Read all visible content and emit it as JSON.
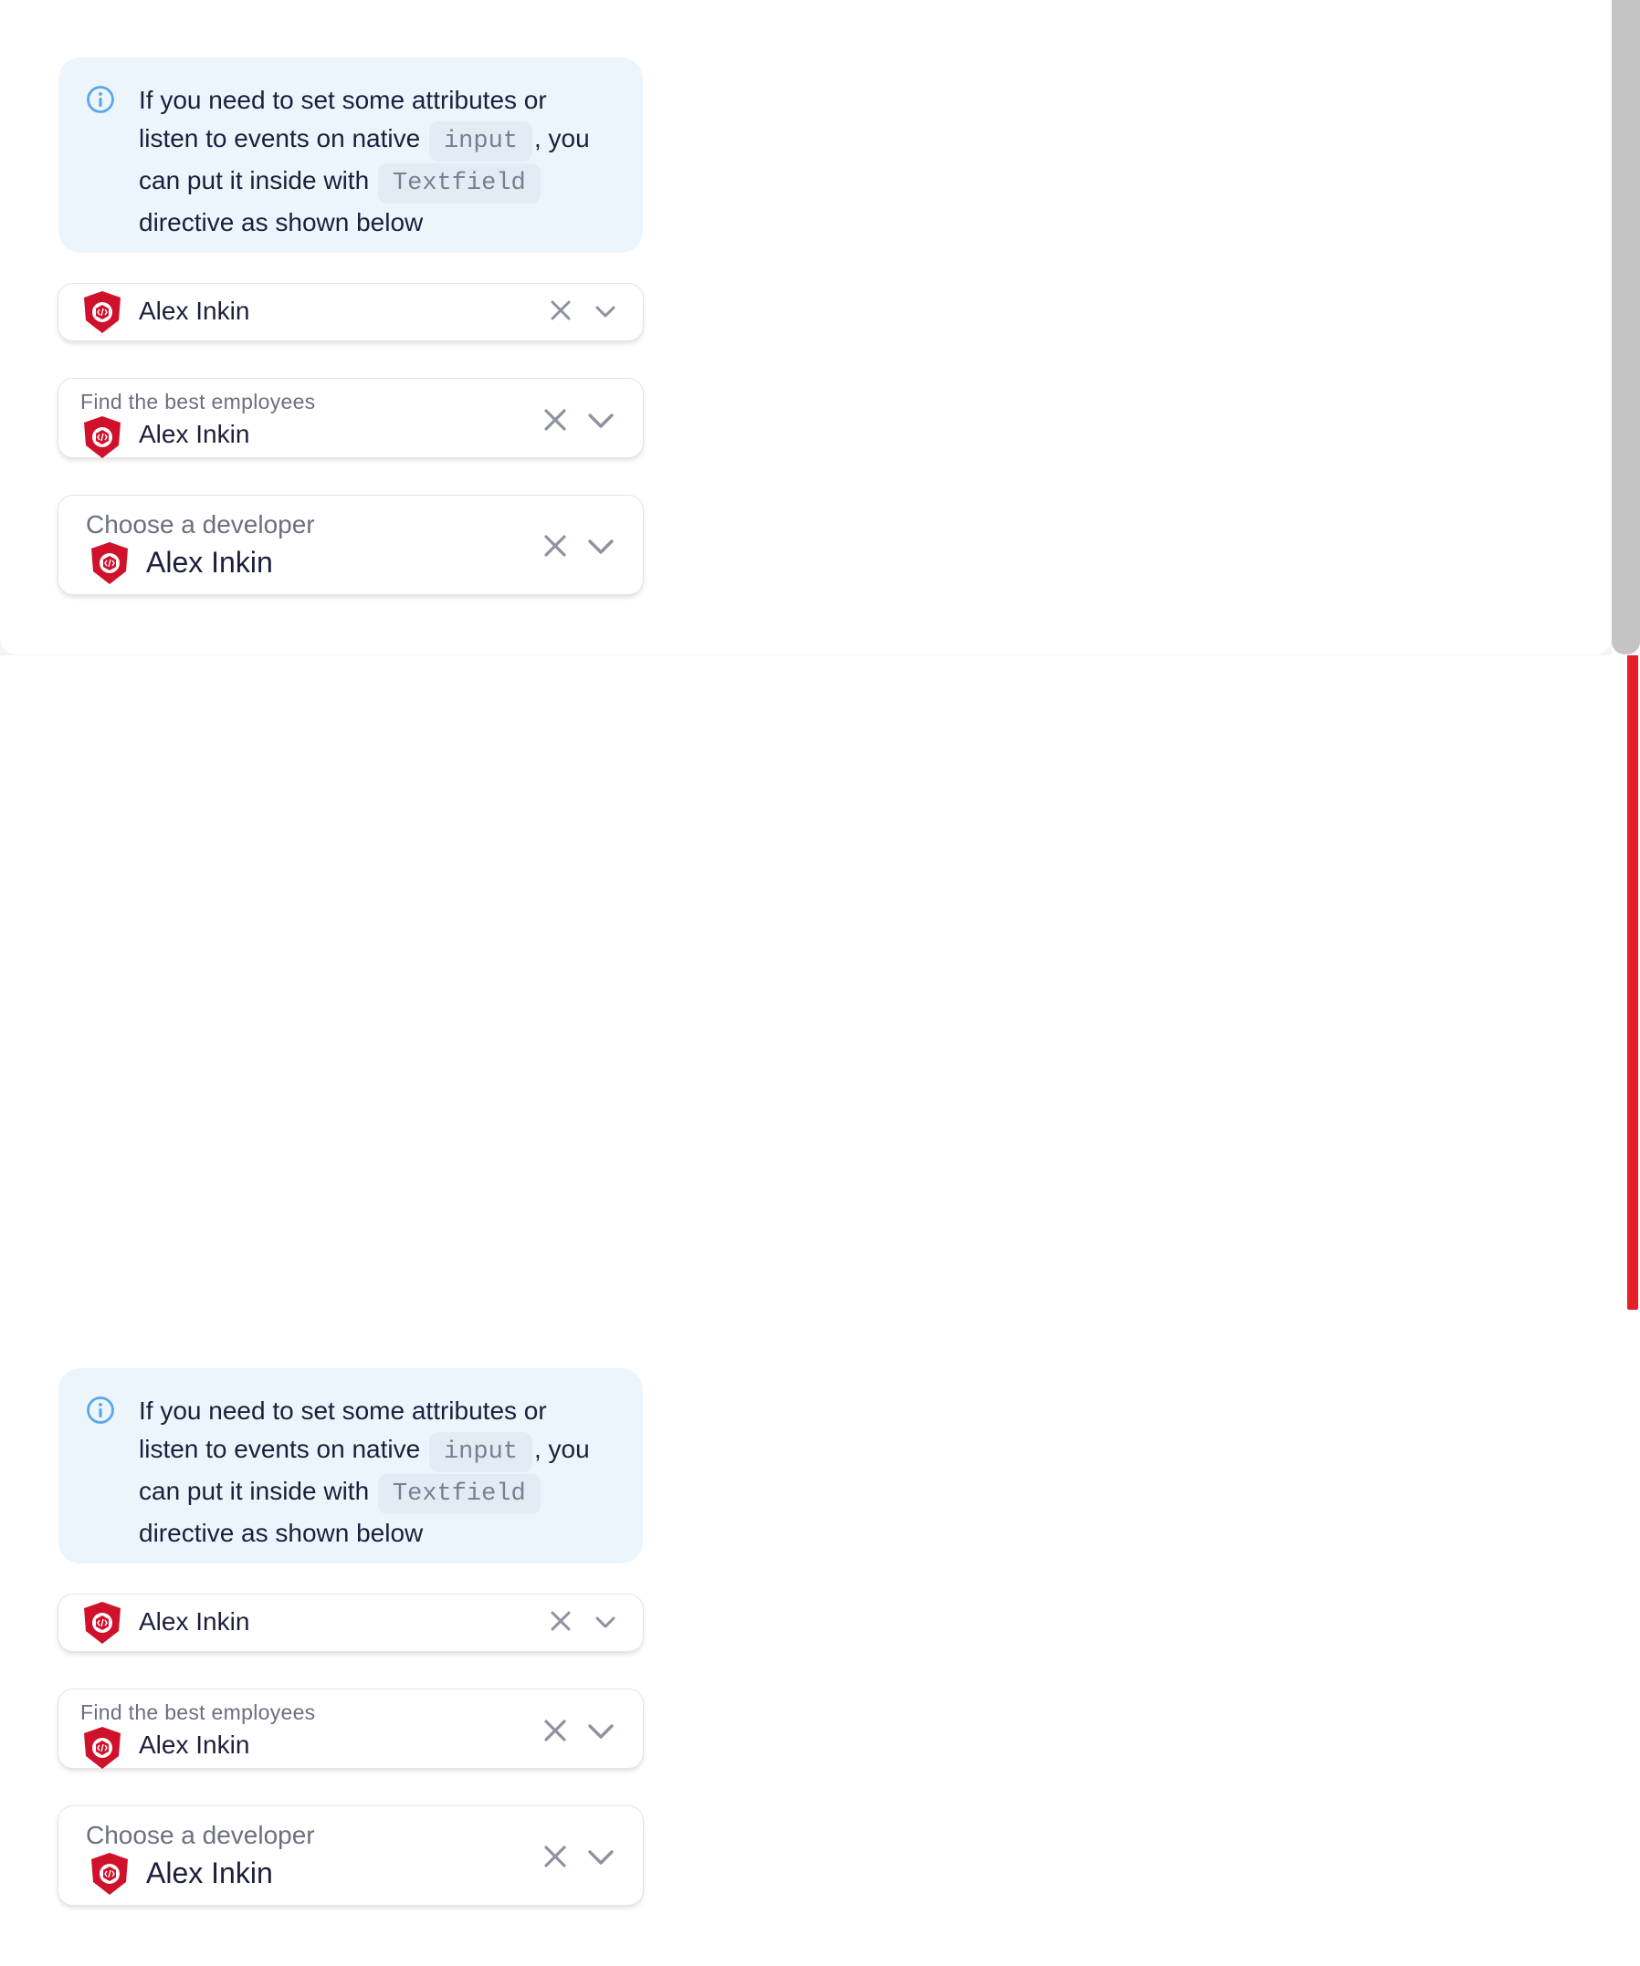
{
  "notification": {
    "text_1": "If you need to set some attributes or listen to events on native ",
    "code_1": "input",
    "text_2": ", you can put it inside with ",
    "code_2": "Textfield",
    "text_3": " directive as shown below"
  },
  "combos": {
    "small": {
      "value": "Alex Inkin"
    },
    "medium": {
      "label": "Find the best employees",
      "value": "Alex Inkin"
    },
    "large": {
      "label": "Choose a developer",
      "value": "Alex Inkin"
    }
  },
  "icons": {
    "info": "info-icon",
    "avatar": "taiga-ui-logo-icon",
    "clear": "close-icon",
    "dropdown": "chevron-down-icon"
  },
  "colors": {
    "accent_red": "#e51f2a",
    "notification_bg": "#edf5fc",
    "info_blue": "#5aa7e8",
    "logo_red": "#d0112b",
    "scrollbar_gray": "#c4c4c4"
  }
}
